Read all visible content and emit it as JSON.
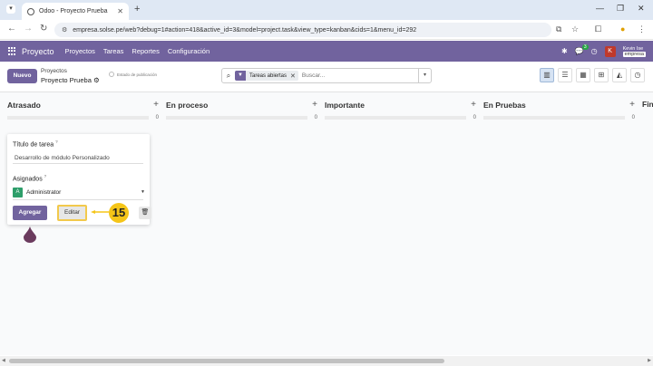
{
  "browser": {
    "tab_title": "Odoo - Proyecto Prueba",
    "url": "empresa.solse.pe/web?debug=1#action=418&active_id=3&model=project.task&view_type=kanban&cids=1&menu_id=292"
  },
  "nav": {
    "app_name": "Proyecto",
    "menu": [
      "Proyectos",
      "Tareas",
      "Reportes",
      "Configuración"
    ],
    "chat_badge": "3",
    "avatar_letter": "K",
    "user_name": "Kevin Ise",
    "company": "empresa"
  },
  "control": {
    "new_label": "Nuevo",
    "breadcrumb_parent": "Proyectos",
    "breadcrumb_current": "Proyecto Prueba",
    "showcase_label": "Estado de publicación",
    "facet_label": "Tareas abiertas",
    "search_placeholder": "Buscar..."
  },
  "columns": [
    {
      "title": "Atrasado",
      "count": "0"
    },
    {
      "title": "En proceso",
      "count": "0"
    },
    {
      "title": "Importante",
      "count": "0"
    },
    {
      "title": "En Pruebas",
      "count": "0"
    },
    {
      "title": "Fin",
      "count": ""
    }
  ],
  "quick_create": {
    "title_label": "Título de tarea",
    "title_value": "Desarrollo de módulo Personalizado",
    "assignees_label": "Asignados",
    "help_mark": "?",
    "assignee_initial": "A",
    "assignee_name": "Administrator",
    "add_label": "Agregar",
    "edit_label": "Editar"
  },
  "tutorial": {
    "step_number": "15",
    "accent": "#f5c518"
  },
  "colors": {
    "brand": "#71639e",
    "assignee_avatar": "#2e9e6a",
    "user_avatar": "#c0392b"
  }
}
